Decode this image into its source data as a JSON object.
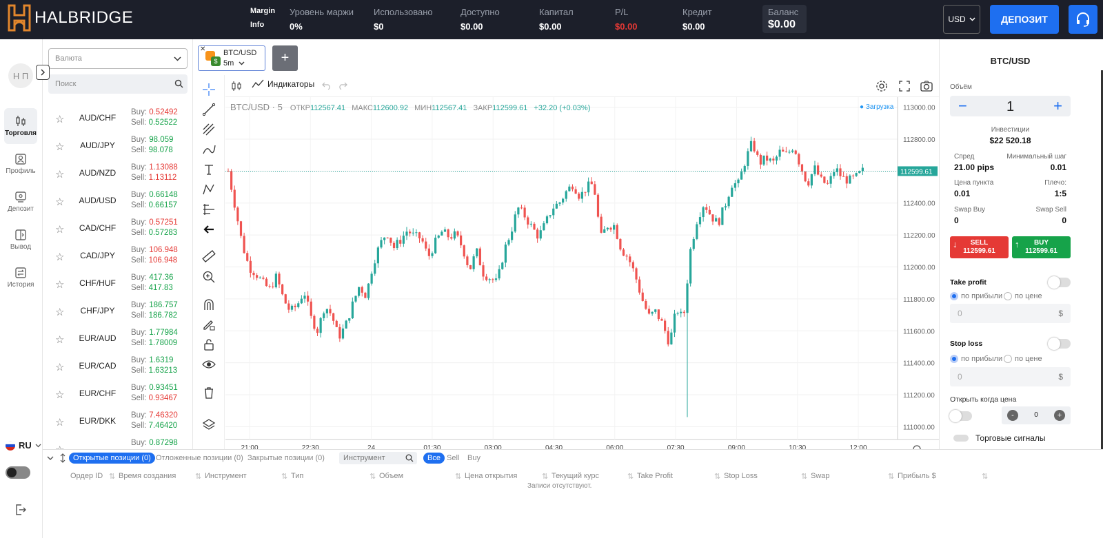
{
  "header": {
    "brand": "HALBRIDGE",
    "margin_info_1": "Margin",
    "margin_info_2": "Info",
    "stats": [
      {
        "label": "Уровень маржи",
        "value": "0%"
      },
      {
        "label": "Использовано",
        "value": "$0"
      },
      {
        "label": "Доступно",
        "value": "$0.00"
      },
      {
        "label": "Капитал",
        "value": "$0.00"
      },
      {
        "label": "P/L",
        "value": "$0.00"
      },
      {
        "label": "Кредит",
        "value": "$0.00"
      }
    ],
    "balance_label": "Баланс",
    "balance_value": "$0.00",
    "currency": "USD",
    "deposit_button": "ДЕПОЗИТ"
  },
  "nav": {
    "avatar": "Н П",
    "items": [
      {
        "label": "Торговля",
        "icon": "trade-icon"
      },
      {
        "label": "Профиль",
        "icon": "profile-icon"
      },
      {
        "label": "Депозит",
        "icon": "deposit-icon"
      },
      {
        "label": "Вывод",
        "icon": "withdraw-icon"
      },
      {
        "label": "История",
        "icon": "history-icon"
      }
    ],
    "language": "RU"
  },
  "currency_list": {
    "select_placeholder": "Валюта",
    "search_placeholder": "Поиск",
    "buy_label": "Buy:",
    "sell_label": "Sell:",
    "items": [
      {
        "name": "AUD/CHF",
        "buy": "0.52492",
        "sell": "0.52522",
        "buy_color": "red",
        "sell_color": "grn"
      },
      {
        "name": "AUD/JPY",
        "buy": "98.059",
        "sell": "98.078",
        "buy_color": "grn",
        "sell_color": "grn"
      },
      {
        "name": "AUD/NZD",
        "buy": "1.13088",
        "sell": "1.13112",
        "buy_color": "red",
        "sell_color": "red"
      },
      {
        "name": "AUD/USD",
        "buy": "0.66148",
        "sell": "0.66157",
        "buy_color": "grn",
        "sell_color": "grn"
      },
      {
        "name": "CAD/CHF",
        "buy": "0.57251",
        "sell": "0.57283",
        "buy_color": "red",
        "sell_color": "grn"
      },
      {
        "name": "CAD/JPY",
        "buy": "106.948",
        "sell": "106.948",
        "buy_color": "red",
        "sell_color": "red"
      },
      {
        "name": "CHF/HUF",
        "buy": "417.36",
        "sell": "417.83",
        "buy_color": "grn",
        "sell_color": "grn"
      },
      {
        "name": "CHF/JPY",
        "buy": "186.757",
        "sell": "186.782",
        "buy_color": "grn",
        "sell_color": "grn"
      },
      {
        "name": "EUR/AUD",
        "buy": "1.77984",
        "sell": "1.78009",
        "buy_color": "grn",
        "sell_color": "grn"
      },
      {
        "name": "EUR/CAD",
        "buy": "1.6319",
        "sell": "1.63213",
        "buy_color": "grn",
        "sell_color": "grn"
      },
      {
        "name": "EUR/CHF",
        "buy": "0.93451",
        "sell": "0.93467",
        "buy_color": "grn",
        "sell_color": "red"
      },
      {
        "name": "EUR/DKK",
        "buy": "7.46320",
        "sell": "7.46420",
        "buy_color": "red",
        "sell_color": "grn"
      },
      {
        "name": "",
        "buy": "0.87298",
        "sell": "",
        "buy_color": "grn",
        "sell_color": "grn"
      }
    ]
  },
  "chart_tab": {
    "symbol": "BTC/USD",
    "timeframe": "5m",
    "add": "+"
  },
  "chart_toolbar": {
    "indicators": "Индикаторы"
  },
  "chart_legend": {
    "symbol": "BTC/USD · 5",
    "open_label": "ОТКР",
    "open": "112567.41",
    "high_label": "МАКС",
    "high": "112600.92",
    "low_label": "МИН",
    "low": "112567.41",
    "close_label": "ЗАКР",
    "close": "112599.61",
    "change": "+32.20 (+0.03%)",
    "loading": "● Загрузка"
  },
  "chart_data": {
    "type": "candlestick",
    "y_ticks": [
      "113000.00",
      "112800.00",
      "112600.00",
      "112400.00",
      "112200.00",
      "112000.00",
      "111800.00",
      "111600.00",
      "111400.00",
      "111200.00",
      "111000.00"
    ],
    "ylim": [
      110950,
      113050
    ],
    "x_ticks": [
      "21:00",
      "22:30",
      "24",
      "01:30",
      "03:00",
      "04:30",
      "06:00",
      "07:30",
      "09:00",
      "10:30",
      "12:00"
    ],
    "last_price": "112599.61",
    "last_price_value": 112599.61,
    "path": [
      112600,
      112380,
      112150,
      112000,
      111960,
      111900,
      111860,
      111940,
      111800,
      111720,
      111760,
      111850,
      111680,
      111600,
      111760,
      111700,
      111560,
      111630,
      111760,
      111880,
      111820,
      112020,
      112140,
      112220,
      112120,
      112170,
      112230,
      112190,
      112180,
      112060,
      112150,
      112220,
      112190,
      112200,
      112120,
      111980,
      112100,
      111960,
      111930,
      111900,
      112100,
      112220,
      112370,
      112320,
      112250,
      112190,
      112270,
      112370,
      112400,
      112470,
      112520,
      112440,
      112500,
      112520,
      112180,
      112260,
      112260,
      112110,
      112060,
      111950,
      111800,
      111690,
      111720,
      111640,
      111520,
      111740,
      111670,
      112100,
      112300,
      112400,
      112320,
      112270,
      112380,
      112520,
      112520,
      112670,
      112780,
      112650,
      112680,
      112650,
      112720,
      112700,
      112760,
      112630,
      112520,
      112620,
      112540,
      112510,
      112620,
      112560,
      112540,
      112560,
      112600
    ]
  },
  "order_panel": {
    "title": "BTC/USD",
    "volume_label": "Объём",
    "volume": "1",
    "investment_label": "Инвестиции",
    "investment": "$22 520.18",
    "spread_label": "Спред",
    "spread": "21.00 pips",
    "min_step_label": "Минимальный шаг",
    "min_step": "0.01",
    "point_price_label": "Цена пункта",
    "point_price": "0.01",
    "leverage_label": "Плечо:",
    "leverage": "1:5",
    "swap_buy_label": "Swap Buy",
    "swap_buy": "0",
    "swap_sell_label": "Swap Sell",
    "swap_sell": "0",
    "sell_label": "SELL",
    "sell_price": "112599.61",
    "buy_label": "BUY",
    "buy_price": "112599.61",
    "take_profit": "Take profit",
    "stop_loss": "Stop loss",
    "by_profit": "по прибыли",
    "by_price": "по цене",
    "tp_value": "0",
    "sl_value": "0",
    "dollar": "$",
    "open_when": "Открыть когда цена",
    "minus": "-",
    "plus": "+",
    "open_when_value": "0",
    "signals": "Торговые сигналы"
  },
  "bottom": {
    "tabs": [
      "Открытые позиции (0)",
      "Отложенные позиции (0)",
      "Закрытые позиции (0)"
    ],
    "instrument_placeholder": "Инструмент",
    "filters": [
      "Все",
      "Sell",
      "Buy"
    ],
    "columns": [
      "Ордер ID",
      "Время создания",
      "Инструмент",
      "Тип",
      "Объем",
      "Цена открытия",
      "Текущий курс",
      "Take Profit",
      "Stop Loss",
      "Swap",
      "Прибыль $"
    ],
    "empty": "Записи отсутствуют."
  },
  "colors": {
    "header_bg": "#1c1f2a",
    "accent": "#1e6ff0",
    "up": "#26a69a",
    "down": "#ef5350",
    "sell": "#e53935",
    "buy": "#16a34a"
  }
}
